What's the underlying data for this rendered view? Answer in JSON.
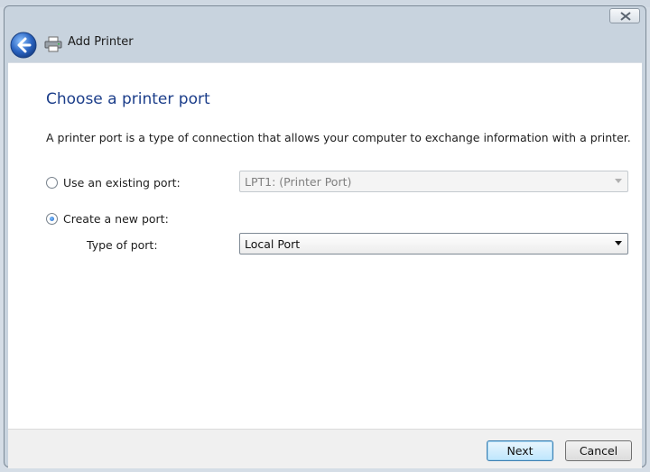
{
  "window": {
    "title": "Add Printer"
  },
  "page": {
    "heading": "Choose a printer port",
    "description": "A printer port is a type of connection that allows your computer to exchange information with a printer."
  },
  "options": {
    "existing_port": {
      "label": "Use an existing port:",
      "selected": false,
      "value": "LPT1: (Printer Port)"
    },
    "new_port": {
      "label": "Create a new port:",
      "selected": true,
      "type_label": "Type of port:",
      "value": "Local Port"
    }
  },
  "buttons": {
    "next": "Next",
    "cancel": "Cancel"
  },
  "icons": {
    "close": "close-icon",
    "back": "back-arrow-icon",
    "printer": "printer-icon",
    "dropdown": "chevron-down-icon"
  },
  "colors": {
    "heading": "#1c3e8a",
    "frame": "#c8d3de",
    "back_button": "#2a64c2"
  }
}
